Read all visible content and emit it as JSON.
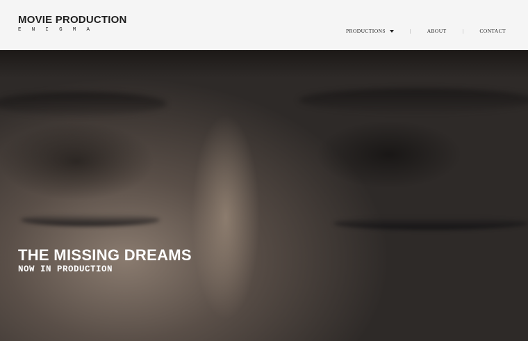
{
  "brand": {
    "title": "MOVIE PRODUCTION",
    "subtitle": "ENIGMA"
  },
  "nav": {
    "items": [
      {
        "label": "PRODUCTIONS",
        "has_dropdown": true
      },
      {
        "label": "ABOUT"
      },
      {
        "label": "CONTACT"
      }
    ],
    "separator": "|"
  },
  "hero": {
    "title": "THE MISSING DREAMS",
    "subtitle": "NOW IN PRODUCTION",
    "image_icon": "hero-image"
  },
  "colors": {
    "header_bg": "#f5f5f5",
    "text_dark": "#1e1e1e",
    "hero_text": "#ffffff"
  }
}
